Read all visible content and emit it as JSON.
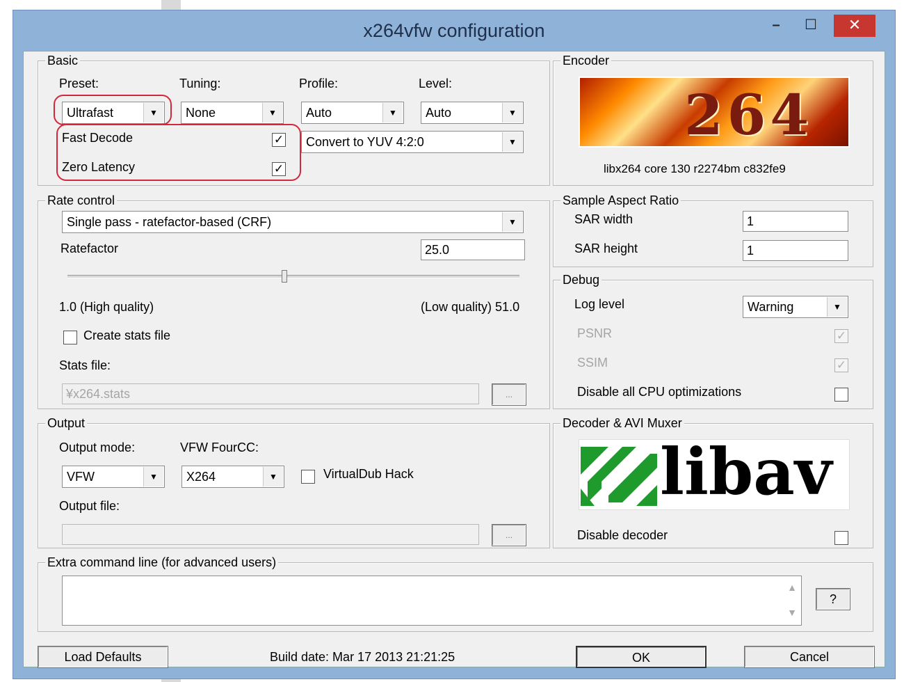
{
  "window": {
    "title": "x264vfw configuration",
    "minimize": "–",
    "maximize": "☐",
    "close": "✕"
  },
  "basic": {
    "legend": "Basic",
    "preset_label": "Preset:",
    "preset_value": "Ultrafast",
    "tuning_label": "Tuning:",
    "tuning_value": "None",
    "profile_label": "Profile:",
    "profile_value": "Auto",
    "level_label": "Level:",
    "level_value": "Auto",
    "fast_decode_label": "Fast Decode",
    "fast_decode_checked": true,
    "zero_latency_label": "Zero Latency",
    "zero_latency_checked": true,
    "colorspace_value": "Convert to YUV 4:2:0"
  },
  "encoder": {
    "legend": "Encoder",
    "logo_text": "264",
    "version": "libx264 core 130 r2274bm c832fe9"
  },
  "rate_control": {
    "legend": "Rate control",
    "mode_value": "Single pass - ratefactor-based (CRF)",
    "ratefactor_label": "Ratefactor",
    "ratefactor_value": "25.0",
    "slider_level": 0.48,
    "min_label": "1.0 (High quality)",
    "max_label": "(Low quality) 51.0",
    "create_stats_label": "Create stats file",
    "stats_file_label": "Stats file:",
    "stats_file_value": "¥x264.stats",
    "browse_label": "..."
  },
  "sar": {
    "legend": "Sample Aspect Ratio",
    "width_label": "SAR width",
    "width_value": "1",
    "height_label": "SAR height",
    "height_value": "1"
  },
  "debug": {
    "legend": "Debug",
    "log_level_label": "Log level",
    "log_level_value": "Warning",
    "psnr_label": "PSNR",
    "ssim_label": "SSIM",
    "disable_cpu_label": "Disable all CPU optimizations"
  },
  "output": {
    "legend": "Output",
    "mode_label": "Output mode:",
    "mode_value": "VFW",
    "fourcc_label": "VFW FourCC:",
    "fourcc_value": "X264",
    "virtualdub_label": "VirtualDub Hack",
    "file_label": "Output file:",
    "browse_label": "..."
  },
  "decoder": {
    "legend": "Decoder & AVI Muxer",
    "logo_text": "libav",
    "disable_label": "Disable decoder"
  },
  "extra": {
    "legend": "Extra command line (for advanced users)",
    "help_label": "?"
  },
  "footer": {
    "load_defaults": "Load Defaults",
    "build_date": "Build date: Mar 17 2013 21:21:25",
    "ok": "OK",
    "cancel": "Cancel"
  },
  "colors": {
    "title_bar": "#8fb2d8",
    "close_button": "#c7362f",
    "highlight_mark": "#d0283c",
    "libav_green": "#1f9a2c"
  }
}
